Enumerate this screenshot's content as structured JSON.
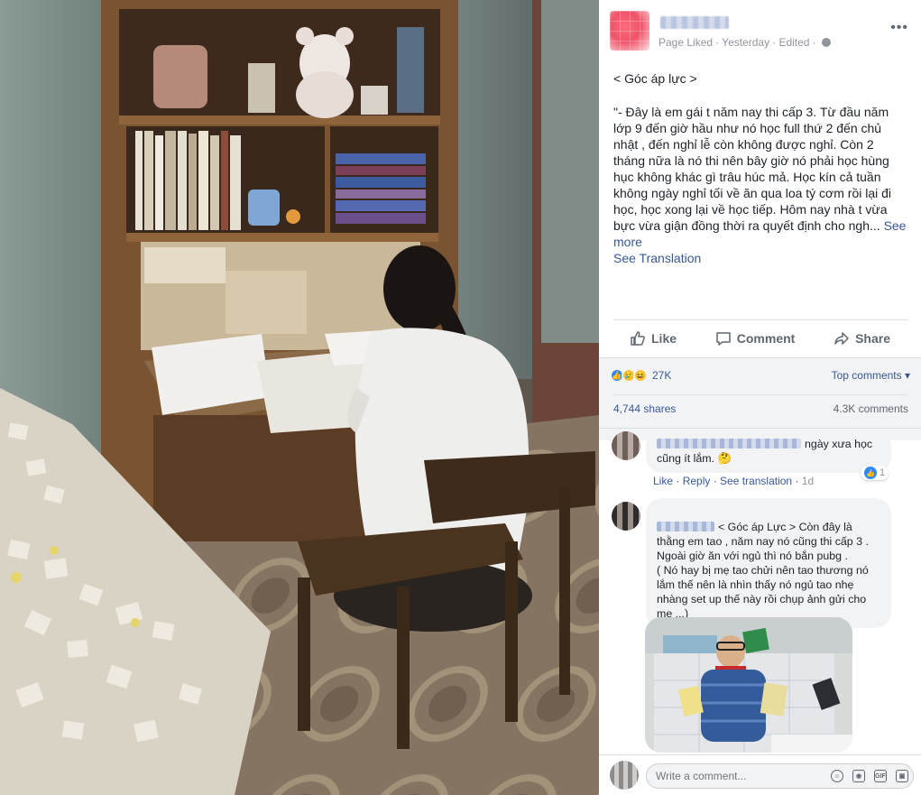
{
  "post": {
    "meta_status": "Page Liked",
    "meta_time": "Yesterday",
    "meta_edited": "Edited",
    "more_icon": "more-dots-icon",
    "title": "< Góc áp lực >",
    "body": "\"- Đây là em gái t năm nay thi cấp 3. Từ đầu năm lớp 9 đến giờ hầu như nó học full thứ 2 đến chủ nhật , đến nghỉ lễ còn không được nghỉ. Còn 2 tháng nữa là nó thi nên bây giờ nó phải học hùng hục không khác gì trâu húc mả. Học kín cả tuần không ngày nghỉ tối về ăn qua loa tý cơm rồi lại đi học, học xong lại về học tiếp. Hôm nay nhà t vừa bực vừa giận đồng thời ra quyết định cho ngh...",
    "see_more": "See more",
    "see_translation": "See Translation"
  },
  "actions": {
    "like": "Like",
    "comment": "Comment",
    "share": "Share"
  },
  "stats": {
    "reactions_count": "27K",
    "top_comments": "Top comments ▾",
    "shares": "4,744 shares",
    "comments": "4.3K comments"
  },
  "comments": [
    {
      "text": "ngày xưa học cũng ít lắm. 🤔",
      "like": "Like",
      "reply": "Reply",
      "see_translation": "See translation",
      "time": "1d",
      "likes": "1"
    },
    {
      "text": "< Góc áp Lực > Còn đây là thằng em tao , năm nay nó cũng thi cấp 3 . Ngoài giờ ăn với ngủ thì nó bắn pubg .\n( Nó hay bị mẹ tao chửi nên tao thương nó lắm thế nên là nhìn thấy nó ngủ tao nhẹ nhàng set up thế này rồi chụp ảnh gửi cho mẹ ...)"
    }
  ],
  "write": {
    "placeholder": "Write a comment..."
  },
  "colors": {
    "link": "#385898",
    "muted": "#90949c",
    "reaction_like": "#2e89ff"
  }
}
